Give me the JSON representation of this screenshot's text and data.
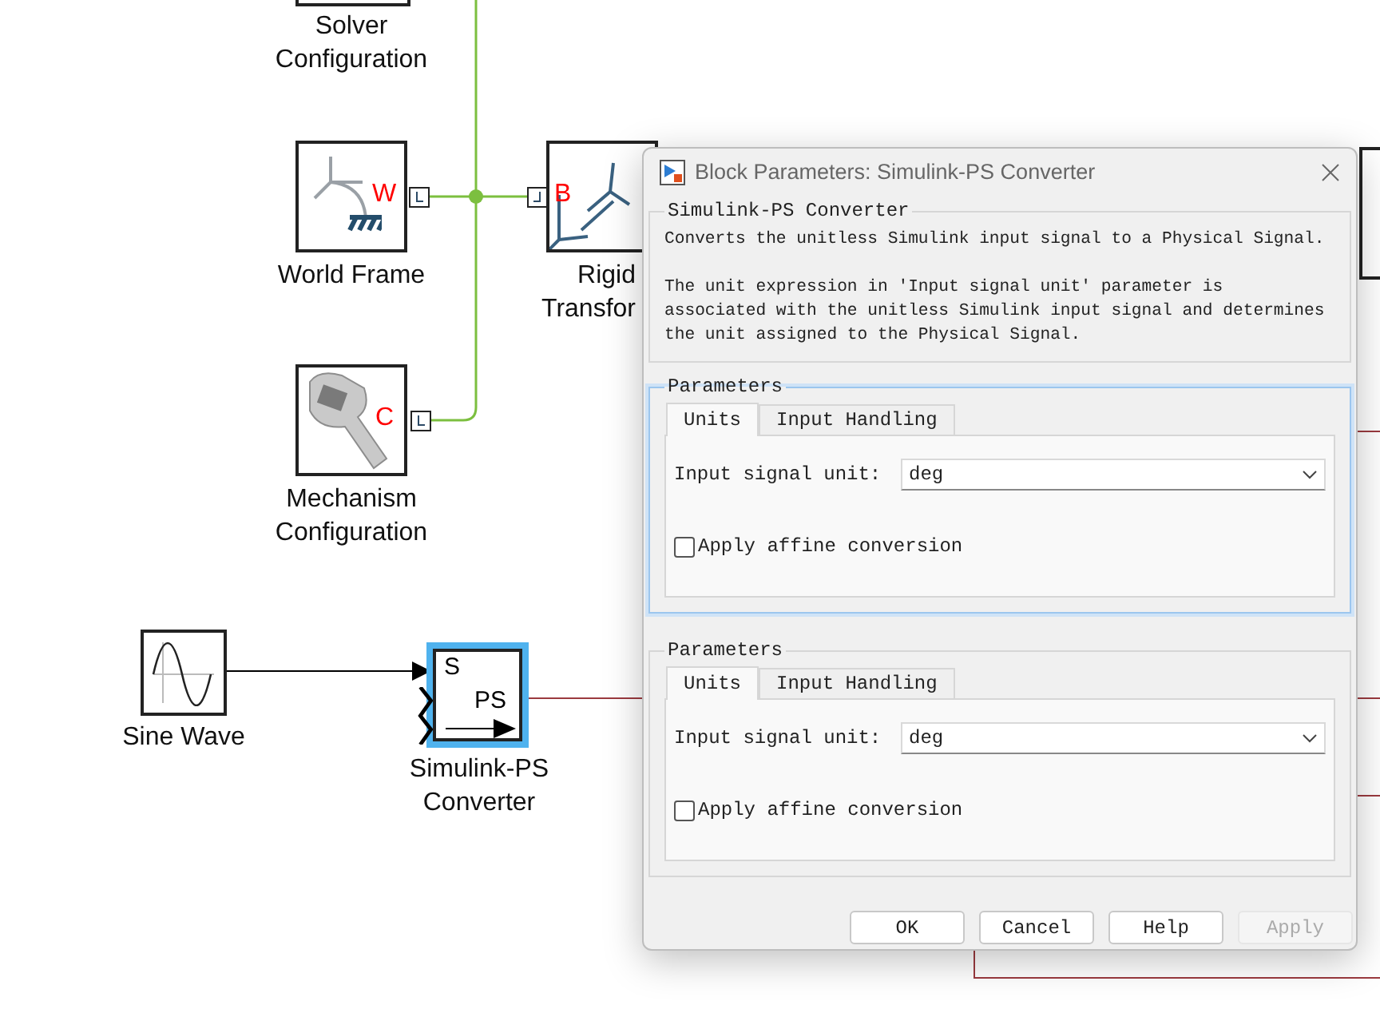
{
  "canvas": {
    "blocks": [
      {
        "kind": "solver",
        "label": [
          "Solver",
          "Configuration"
        ]
      },
      {
        "kind": "world",
        "label": [
          "World Frame"
        ],
        "port_letter": "W"
      },
      {
        "kind": "rigid",
        "label": [
          "Rigid",
          "Transfor"
        ],
        "port_letter": "B"
      },
      {
        "kind": "mechanism",
        "label": [
          "Mechanism",
          "Configuration"
        ],
        "port_letter": "C"
      },
      {
        "kind": "sine",
        "label": [
          "Sine Wave"
        ]
      },
      {
        "kind": "converter",
        "label": [
          "Simulink-PS",
          "Converter"
        ],
        "selected": true,
        "input_letter": "S",
        "output_letter": "PS"
      },
      {
        "kind": "edge"
      }
    ]
  },
  "dialog": {
    "title": "Block Parameters: Simulink-PS Converter",
    "description_group": {
      "title": "Simulink-PS Converter",
      "paragraphs": [
        "Converts the unitless Simulink input signal to a Physical Signal.",
        "The unit expression in 'Input signal unit' parameter is associated with the unitless Simulink input signal and determines the unit assigned to the Physical Signal."
      ]
    },
    "parameter_groups": [
      {
        "title": "Parameters",
        "focused": true,
        "tabs": [
          {
            "label": "Units",
            "selected": true
          },
          {
            "label": "Input Handling",
            "selected": false
          }
        ],
        "unit_label": "Input signal unit:",
        "unit_value": "deg",
        "affine_label": "Apply affine conversion",
        "affine_checked": false
      },
      {
        "title": "Parameters",
        "focused": false,
        "tabs": [
          {
            "label": "Units",
            "selected": true
          },
          {
            "label": "Input Handling",
            "selected": false
          }
        ],
        "unit_label": "Input signal unit:",
        "unit_value": "deg",
        "affine_label": "Apply affine conversion",
        "affine_checked": false
      }
    ],
    "buttons": [
      {
        "label": "OK",
        "disabled": false
      },
      {
        "label": "Cancel",
        "disabled": false
      },
      {
        "label": "Help",
        "disabled": false
      },
      {
        "label": "Apply",
        "disabled": true
      }
    ]
  }
}
